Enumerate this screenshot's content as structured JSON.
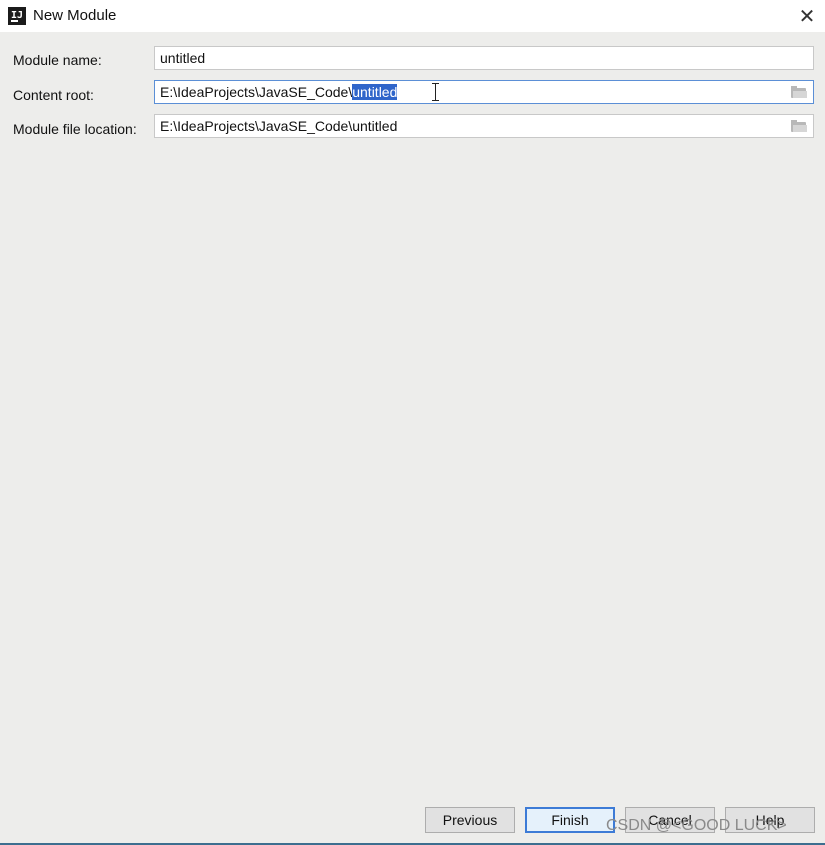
{
  "window": {
    "title": "New Module",
    "close_icon": "close-icon"
  },
  "form": {
    "module_name": {
      "label": "Module name:",
      "value": "untitled"
    },
    "content_root": {
      "label": "Content root:",
      "value_prefix": "E:\\IdeaProjects\\JavaSE_Code\\",
      "value_selected": "untitled"
    },
    "module_file_location": {
      "label": "Module file location:",
      "value": "E:\\IdeaProjects\\JavaSE_Code\\untitled"
    }
  },
  "buttons": {
    "previous": "Previous",
    "finish": "Finish",
    "cancel": "Cancel",
    "help": "Help"
  },
  "watermark": "CSDN @<GOOD LUCK>",
  "colors": {
    "selection": "#2f65ca",
    "background": "#ededeb",
    "default_button_border": "#3d7bd6"
  }
}
